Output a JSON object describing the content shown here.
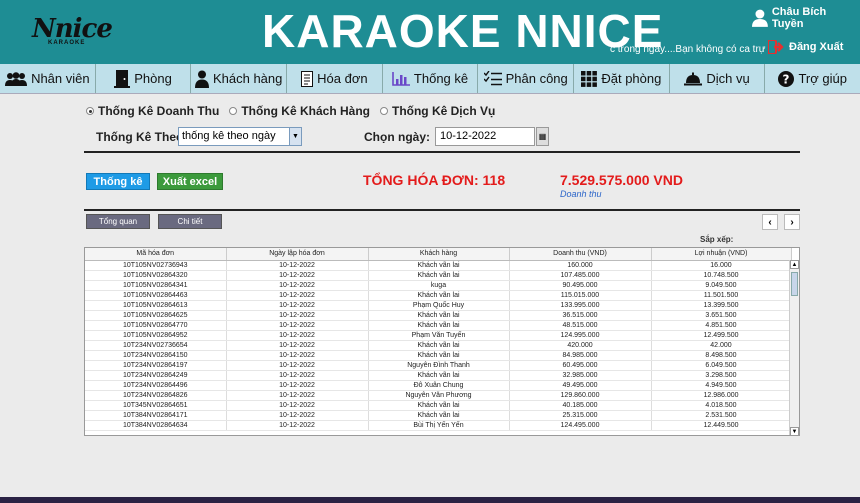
{
  "header": {
    "logo_main": "Nnice",
    "logo_sub": "KARAOKE",
    "title": "KARAOKE NNICE",
    "marquee": "c trong ngày....Bạn không có ca trự",
    "user_name": "Châu Bích Tuyền",
    "logout_label": "Đăng Xuất",
    "accent_color": "#1e8d94"
  },
  "nav": [
    {
      "label": "Nhân viên",
      "icon": "users-icon"
    },
    {
      "label": "Phòng",
      "icon": "door-icon"
    },
    {
      "label": "Khách hàng",
      "icon": "customer-icon"
    },
    {
      "label": "Hóa đơn",
      "icon": "receipt-icon"
    },
    {
      "label": "Thống kê",
      "icon": "chart-icon"
    },
    {
      "label": "Phân công",
      "icon": "checklist-icon"
    },
    {
      "label": "Đặt phòng",
      "icon": "grid-icon"
    },
    {
      "label": "Dịch vụ",
      "icon": "service-bell-icon"
    },
    {
      "label": "Trợ giúp",
      "icon": "help-icon"
    }
  ],
  "filters": {
    "radio_revenue": "Thống Kê Doanh Thu",
    "radio_customer": "Thống Kê Khách Hàng",
    "radio_service": "Thống Kê Dịch Vụ",
    "stat_by_label": "Thống Kê Theo:",
    "stat_by_value": "thống kê theo ngày",
    "date_label": "Chọn ngày:",
    "date_value": "10-12-2022"
  },
  "actions": {
    "stat_button": "Thống kê",
    "excel_button": "Xuất excel"
  },
  "summary": {
    "total_bill": "TỔNG HÓA ĐƠN: 118",
    "revenue_value": "7.529.575.000 VND",
    "revenue_label": "Doanh thu"
  },
  "tabs": {
    "overview": "Tổng quan",
    "detail": "Chi tiết",
    "prev": "‹",
    "next": "›",
    "sort_label": "Sắp xếp:"
  },
  "table": {
    "columns": [
      "Mã hóa đơn",
      "Ngày lập hóa đơn",
      "Khách hàng",
      "Doanh thu (VND)",
      "Lợi nhuận (VND)"
    ],
    "rows": [
      [
        "10T105NV02736943",
        "10-12-2022",
        "Khách vãn lai",
        "160.000",
        "16.000"
      ],
      [
        "10T105NV02864320",
        "10-12-2022",
        "Khách vãn lai",
        "107.485.000",
        "10.748.500"
      ],
      [
        "10T105NV02864341",
        "10-12-2022",
        "kuga",
        "90.495.000",
        "9.049.500"
      ],
      [
        "10T105NV02864463",
        "10-12-2022",
        "Khách vãn lai",
        "115.015.000",
        "11.501.500"
      ],
      [
        "10T105NV02864613",
        "10-12-2022",
        "Phạm Quốc Huy",
        "133.995.000",
        "13.399.500"
      ],
      [
        "10T105NV02864625",
        "10-12-2022",
        "Khách vãn lai",
        "36.515.000",
        "3.651.500"
      ],
      [
        "10T105NV02864770",
        "10-12-2022",
        "Khách vãn lai",
        "48.515.000",
        "4.851.500"
      ],
      [
        "10T105NV02864952",
        "10-12-2022",
        "Phạm Văn Tuyến",
        "124.995.000",
        "12.499.500"
      ],
      [
        "10T234NV02736654",
        "10-12-2022",
        "Khách vãn lai",
        "420.000",
        "42.000"
      ],
      [
        "10T234NV02864150",
        "10-12-2022",
        "Khách vãn lai",
        "84.985.000",
        "8.498.500"
      ],
      [
        "10T234NV02864197",
        "10-12-2022",
        "Nguyễn Đình Thanh",
        "60.495.000",
        "6.049.500"
      ],
      [
        "10T234NV02864249",
        "10-12-2022",
        "Khách vãn lai",
        "32.985.000",
        "3.298.500"
      ],
      [
        "10T234NV02864496",
        "10-12-2022",
        "Đỗ Xuân Chung",
        "49.495.000",
        "4.949.500"
      ],
      [
        "10T234NV02864826",
        "10-12-2022",
        "Nguyễn Văn Phương",
        "129.860.000",
        "12.986.000"
      ],
      [
        "10T345NV02864651",
        "10-12-2022",
        "Khách vãn lai",
        "40.185.000",
        "4.018.500"
      ],
      [
        "10T384NV02864171",
        "10-12-2022",
        "Khách vãn lai",
        "25.315.000",
        "2.531.500"
      ],
      [
        "10T384NV02864634",
        "10-12-2022",
        "Bùi Thị Yến Yến",
        "124.495.000",
        "12.449.500"
      ]
    ]
  }
}
